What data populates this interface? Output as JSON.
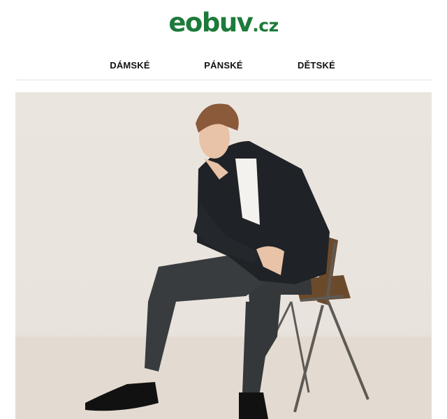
{
  "logo": {
    "main": "eobuv",
    "tld": ".cz"
  },
  "nav": {
    "items": [
      {
        "label": "DÁMSKÉ"
      },
      {
        "label": "PÁNSKÉ"
      },
      {
        "label": "DĚTSKÉ"
      }
    ]
  },
  "hero": {
    "colors": {
      "background": "#ebe5df",
      "floor": "#e1d8cd",
      "jacket": "#1f2226",
      "trousers": "#34383a",
      "shirt": "#f4f2ee",
      "skin": "#e8c3a8",
      "hair": "#8a5a3a",
      "chair_seat": "#6b4a2c",
      "chair_frame": "#5e5a55",
      "shoes": "#111111"
    }
  },
  "brand": {
    "accent": "#1d7a3a"
  }
}
